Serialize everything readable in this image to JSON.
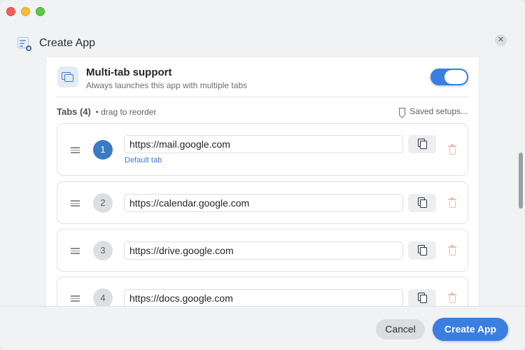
{
  "window": {
    "title": "Create App"
  },
  "multi_tab": {
    "title": "Multi-tab support",
    "subtitle": "Always launches this app with multiple tabs",
    "enabled": true
  },
  "tabs_section": {
    "label": "Tabs (4)",
    "hint": "• drag to reorder",
    "saved_setups": "Saved setups..."
  },
  "tabs": [
    {
      "number": "1",
      "url": "https://mail.google.com",
      "default_label": "Default tab"
    },
    {
      "number": "2",
      "url": "https://calendar.google.com"
    },
    {
      "number": "3",
      "url": "https://drive.google.com"
    },
    {
      "number": "4",
      "url": "https://docs.google.com"
    }
  ],
  "footer": {
    "cancel_label": "Cancel",
    "create_label": "Create App"
  },
  "colors": {
    "accent": "#3a7ee0",
    "delete": "#f3b8b6"
  }
}
